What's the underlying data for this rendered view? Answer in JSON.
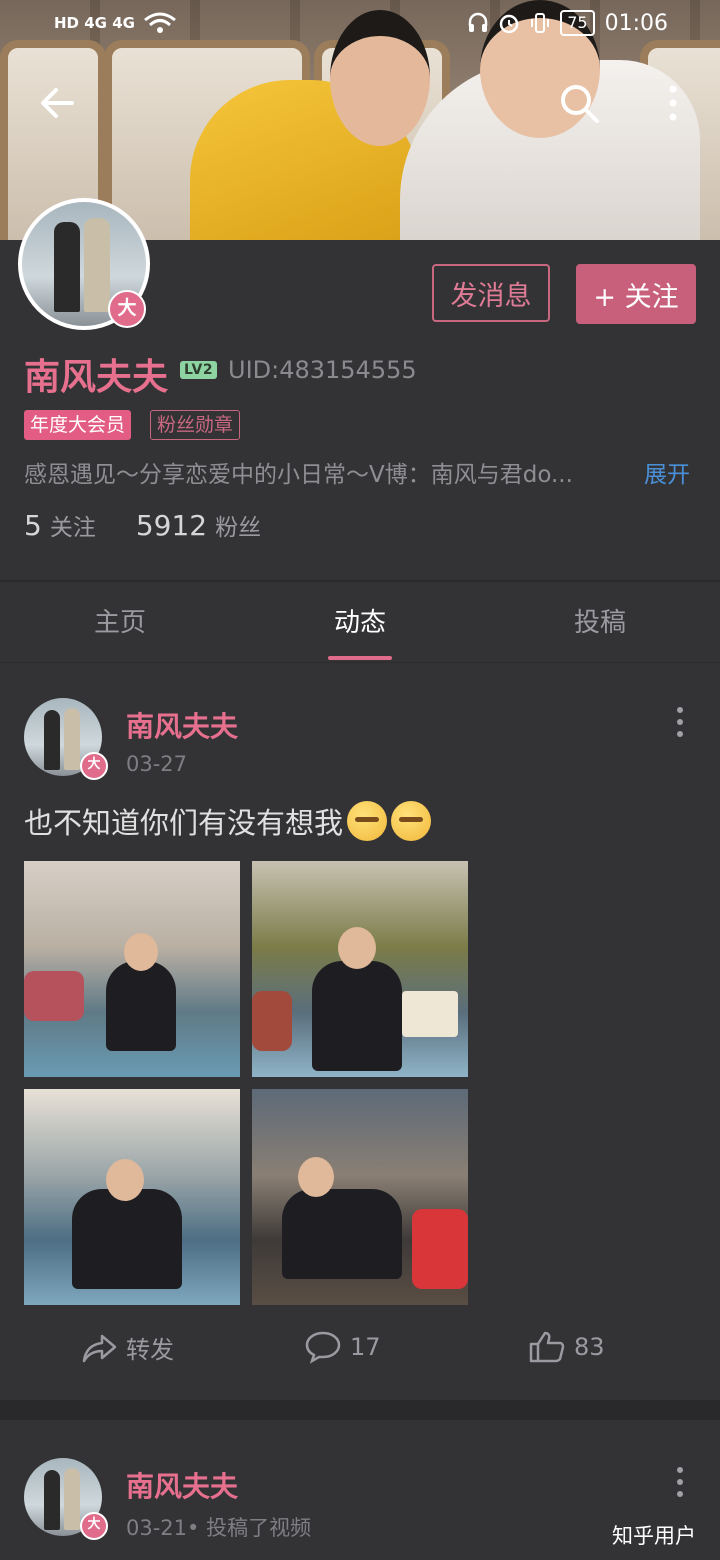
{
  "status_bar": {
    "left": "HD  4G  4G",
    "battery": "75",
    "time": "01:06"
  },
  "header": {
    "back_icon": "arrow-left-icon",
    "search_icon": "search-icon",
    "more_icon": "more-vertical-icon"
  },
  "profile": {
    "avatar_badge": "大",
    "send_message_label": "发消息",
    "follow_label": "+ 关注",
    "name": "南风夫夫",
    "level": "LV2",
    "uid": "UID:483154555",
    "tags": [
      "年度大会员",
      "粉丝勋章"
    ],
    "bio": "感恩遇见～分享恋爱中的小日常～V博：南风与君do...",
    "expand_label": "展开",
    "following_count": "5",
    "following_label": "关注",
    "followers_count": "5912",
    "followers_label": "粉丝"
  },
  "tabs": [
    {
      "label": "主页"
    },
    {
      "label": "动态"
    },
    {
      "label": "投稿"
    }
  ],
  "posts": [
    {
      "author": "南风夫夫",
      "badge": "大",
      "date": "03-27",
      "text": "也不知道你们有没有想我",
      "repost_label": "转发",
      "comments": "17",
      "likes": "83"
    },
    {
      "author": "南风夫夫",
      "badge": "大",
      "date": "03-21• 投稿了视频"
    }
  ],
  "watermark": "知乎用户",
  "colors": {
    "accent": "#e06b8b",
    "background": "#333336",
    "link": "#4a90d9"
  }
}
